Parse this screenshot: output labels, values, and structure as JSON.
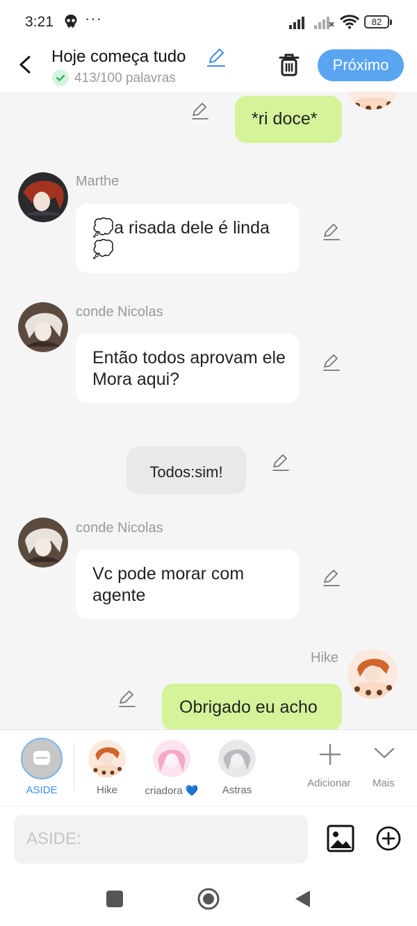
{
  "status": {
    "time": "3:21",
    "dots": "···",
    "battery": "82"
  },
  "header": {
    "title": "Hoje começa tudo",
    "word_count": "413/100 palavras",
    "next_label": "Próximo"
  },
  "messages": [
    {
      "side": "right",
      "text": "*ri doce*",
      "style": "green"
    },
    {
      "side": "left",
      "sender": "Marthe",
      "text": "💭a risada dele é linda 💭"
    },
    {
      "side": "left",
      "sender": "conde Nicolas",
      "text": "Então todos aprovam ele Mora aqui?"
    },
    {
      "side": "center",
      "text": "Todos:sim!"
    },
    {
      "side": "left",
      "sender": "conde Nicolas",
      "text": "Vc pode morar com agente"
    },
    {
      "side": "right",
      "sender": "Hike",
      "text": "Obrigado eu acho",
      "style": "green"
    }
  ],
  "characters": [
    {
      "name": "ASIDE"
    },
    {
      "name": "Hike"
    },
    {
      "name": "criadora 💙"
    },
    {
      "name": "Astras"
    }
  ],
  "actions": {
    "add_label": "Adicionar",
    "more_label": "Mais"
  },
  "input": {
    "placeholder": "ASIDE:"
  },
  "colors": {
    "accent": "#5aa5f2",
    "green_bubble": "#d5f49a",
    "white_bubble": "#ffffff",
    "system_bubble": "#e9e9e9"
  }
}
